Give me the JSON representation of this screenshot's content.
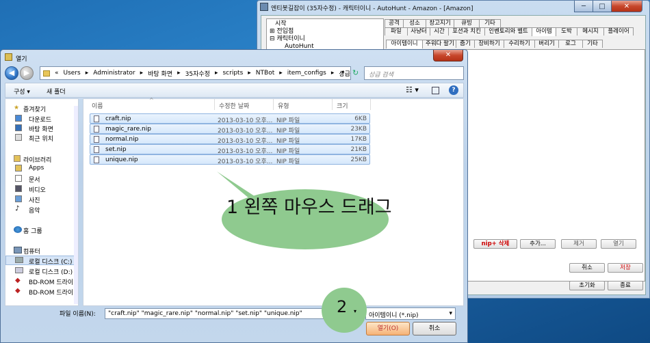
{
  "back_window": {
    "title": "엔티봇길잡이 (35자수정) - 캐릭터이니 - AutoHunt - Amazon - [Amazon]",
    "tree": [
      "시작",
      "전입점",
      "캐릭터이니",
      "AutoHunt"
    ],
    "tabs_row1": [
      "공격",
      "성소",
      "창고지기",
      "큐빙",
      "기타"
    ],
    "tabs_row2": [
      "파일",
      "사냥터",
      "시간",
      "포션과 치킨",
      "인벤토리와 벨트",
      "아이템",
      "도박",
      "메시지",
      "플레이어"
    ],
    "tabs_row3": [
      "아이템이니",
      "주워다 팔기",
      "줍기",
      "장비하기",
      "수리하기",
      "버리기",
      "로그",
      "기타"
    ],
    "panel_buttons": [
      "nip+ 삭제",
      "추가...",
      "제거",
      "열기"
    ],
    "bottom_buttons": [
      "취소",
      "저장",
      "초기화",
      "종료"
    ]
  },
  "dialog": {
    "title": "열기",
    "address": [
      "«",
      "Users",
      "▸",
      "Administrator",
      "▸",
      "바탕 화면",
      "▸",
      "35자수정",
      "▸",
      "scripts",
      "▸",
      "NTBot",
      "▸",
      "item_configs",
      "▸",
      "상급"
    ],
    "search_placeholder": "상급 검색",
    "toolbar": {
      "organize": "구성 ▾",
      "new_folder": "새 폴더"
    },
    "nav": {
      "favorites": "즐겨찾기",
      "downloads": "다운로드",
      "desktop": "바탕 화면",
      "recent": "최근 위치",
      "libraries": "라이브러리",
      "apps": "Apps",
      "documents": "문서",
      "videos": "비디오",
      "pictures": "사진",
      "music": "음악",
      "homegroup": "홈 그룹",
      "computer": "컴퓨터",
      "local_c": "로컬 디스크 (C:)",
      "local_d": "로컬 디스크 (D:)",
      "bd1": "BD-ROM 드라이",
      "bd2": "BD-ROM 드라이"
    },
    "columns": [
      "이름",
      "수정한 날짜",
      "유형",
      "크기"
    ],
    "files": [
      {
        "name": "craft.nip",
        "date": "2013-03-10 오후...",
        "type": "NIP 파일",
        "size": "6KB"
      },
      {
        "name": "magic_rare.nip",
        "date": "2013-03-10 오후...",
        "type": "NIP 파일",
        "size": "23KB"
      },
      {
        "name": "normal.nip",
        "date": "2013-03-10 오후...",
        "type": "NIP 파일",
        "size": "17KB"
      },
      {
        "name": "set.nip",
        "date": "2013-03-10 오후...",
        "type": "NIP 파일",
        "size": "21KB"
      },
      {
        "name": "unique.nip",
        "date": "2013-03-10 오후...",
        "type": "NIP 파일",
        "size": "25KB"
      }
    ],
    "filename_label": "파일 이름(N):",
    "filename_value": "\"craft.nip\" \"magic_rare.nip\" \"normal.nip\" \"set.nip\" \"unique.nip\"",
    "filetype": "아이템이니 (*.nip)",
    "open_button": "열기(O)",
    "cancel_button": "취소"
  },
  "annotations": {
    "step1": "1 왼쪽 마우스 드래그",
    "step2": "2"
  }
}
